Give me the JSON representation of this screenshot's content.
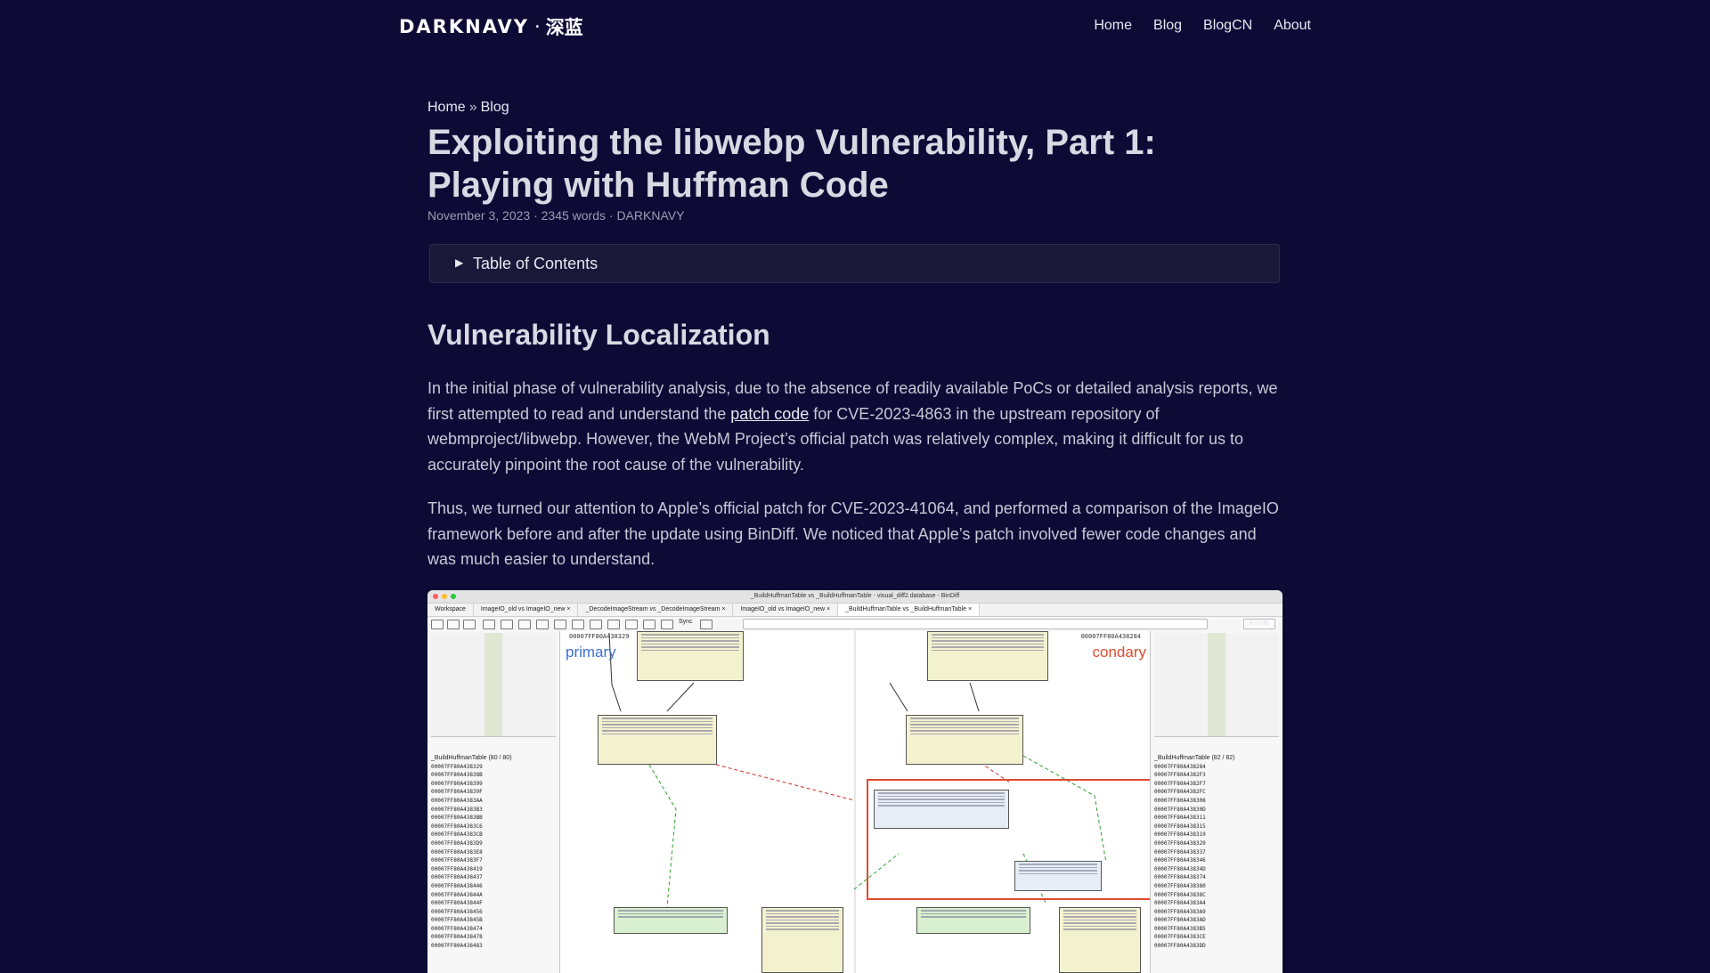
{
  "header": {
    "logo_word": "DARKNAVY",
    "logo_sep": "·",
    "logo_cn": "深蓝",
    "nav": [
      "Home",
      "Blog",
      "BlogCN",
      "About"
    ]
  },
  "breadcrumb": {
    "home": "Home",
    "sep": "»",
    "blog": "Blog"
  },
  "article": {
    "title": "Exploiting the libwebp Vulnerability, Part 1: Playing with Huffman Code",
    "meta": "November 3, 2023 · 2345 words · DARKNAVY",
    "toc_label": "Table of Contents",
    "section_heading": "Vulnerability Localization",
    "p1_before": "In the initial phase of vulnerability analysis, due to the absence of readily available PoCs or detailed analysis reports, we first attempted to read and understand the ",
    "p1_link": "patch code",
    "p1_after": " for CVE-2023-4863 in the upstream repository of webmproject/libwebp. However, the WebM Project’s official patch was relatively complex, making it difficult for us to accurately pinpoint the root cause of the vulnerability.",
    "p2": "Thus, we turned our attention to Apple’s official patch for CVE-2023-41064, and performed a comparison of the ImageIO framework before and after the update using BinDiff. We noticed that Apple’s patch involved fewer code changes and was much easier to understand."
  },
  "figure": {
    "window_title": "_BuildHuffmanTable vs _BuildHuffmanTable - visual_diff2.database - BinDiff",
    "tabs": [
      "Workspace",
      "ImageIO_old vs ImageIO_new ×",
      "_DecodeImageStream vs _DecodeImageStream ×",
      "ImageIO_old vs ImageIO_new ×",
      "_BuildHuffmanTable vs _BuildHuffmanTable ×"
    ],
    "toolbar_sync": "Sync",
    "results_label": "Results",
    "primary_label": "primary",
    "secondary_label": "condary",
    "primary_addr": "00007FF80A438329",
    "secondary_addr": "00007FF80A438284",
    "left_tree_header": "_BuildHuffmanTable (80 / 80)",
    "left_tree": [
      "00007FF80A438329",
      "00007FF80A43838B",
      "00007FF80A438399",
      "00007FF80A43839F",
      "00007FF80A4383AA",
      "00007FF80A4383B3",
      "00007FF80A4383BB",
      "00007FF80A4383C6",
      "00007FF80A4383CB",
      "00007FF80A4383D9",
      "00007FF80A4383E8",
      "00007FF80A4383F7",
      "00007FF80A438419",
      "00007FF80A438437",
      "00007FF80A438446",
      "00007FF80A43844A",
      "00007FF80A43844F",
      "00007FF80A438456",
      "00007FF80A43845B",
      "00007FF80A438474",
      "00007FF80A438478",
      "00007FF80A438483"
    ],
    "right_tree_header": "_BuildHuffmanTable (82 / 82)",
    "right_tree": [
      "00007FF80A438284",
      "00007FF80A4382F3",
      "00007FF80A4382F7",
      "00007FF80A4382FC",
      "00007FF80A438308",
      "00007FF80A43830D",
      "00007FF80A438311",
      "00007FF80A438315",
      "00007FF80A438319",
      "00007FF80A438329",
      "00007FF80A438337",
      "00007FF80A438346",
      "00007FF80A43834D",
      "00007FF80A438374",
      "00007FF80A438380",
      "00007FF80A43838C",
      "00007FF80A4383A4",
      "00007FF80A4383A9",
      "00007FF80A4383AD",
      "00007FF80A4383B5",
      "00007FF80A4383CE",
      "00007FF80A4383DD"
    ]
  }
}
